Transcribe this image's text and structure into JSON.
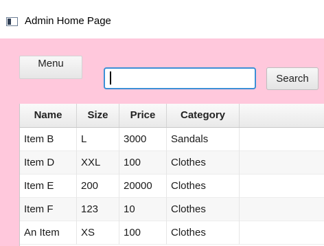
{
  "window": {
    "title": "Admin Home Page"
  },
  "toolbar": {
    "menu_label": "Menu",
    "search_value": "",
    "search_label": "Search"
  },
  "table": {
    "columns": [
      "Name",
      "Size",
      "Price",
      "Category"
    ],
    "rows": [
      [
        "Item B",
        "L",
        "3000",
        "Sandals"
      ],
      [
        "Item D",
        "XXL",
        "100",
        "Clothes"
      ],
      [
        "Item E",
        "200",
        "20000",
        "Clothes"
      ],
      [
        "Item F",
        "123",
        "10",
        "Clothes"
      ],
      [
        "An Item",
        "XS",
        "100",
        "Clothes"
      ]
    ]
  },
  "colors": {
    "background": "#ffc8dc",
    "focus_border": "#3b8fd6"
  },
  "icons": {
    "app": "window-app-icon"
  }
}
